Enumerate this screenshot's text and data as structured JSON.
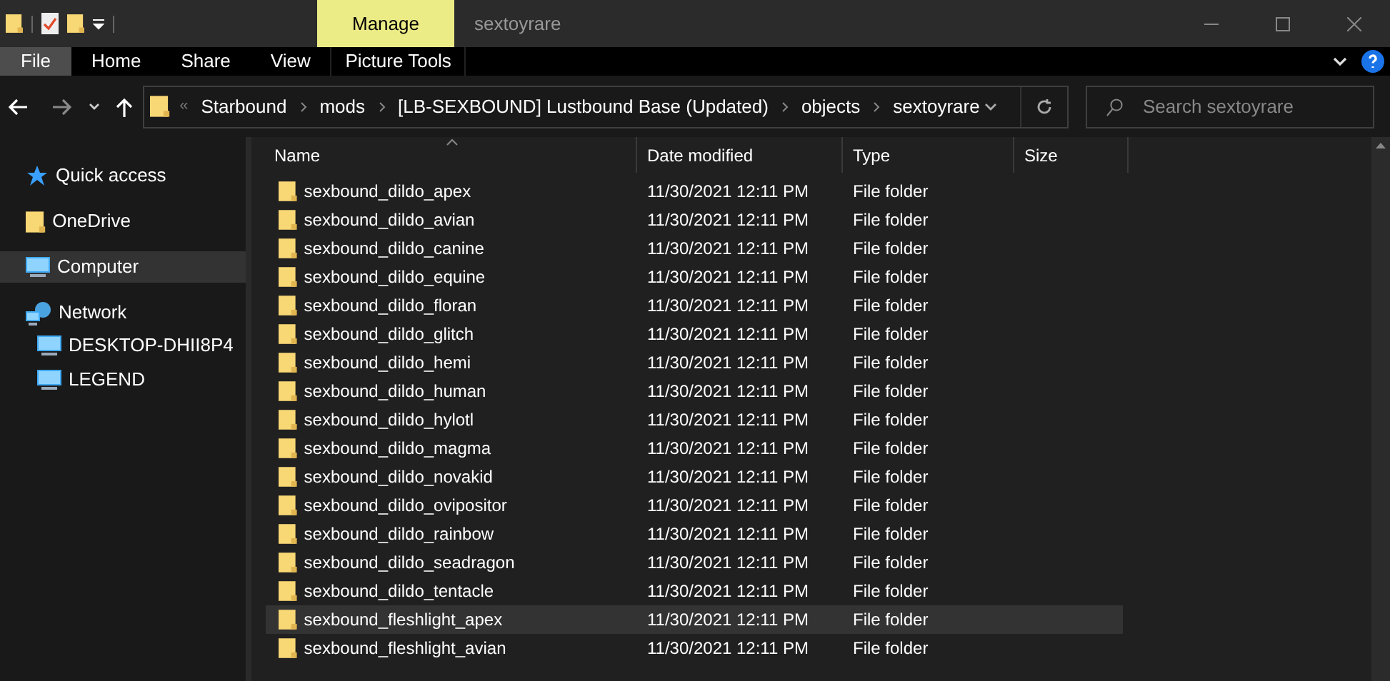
{
  "window": {
    "title": "sextoyrare",
    "contextual_tab": "Manage"
  },
  "ribbon_tabs": [
    {
      "label": "File",
      "kind": "file",
      "selected": true
    },
    {
      "label": "Home",
      "kind": "tab",
      "selected": false
    },
    {
      "label": "Share",
      "kind": "tab",
      "selected": false
    },
    {
      "label": "View",
      "kind": "tab",
      "selected": false
    },
    {
      "label": "Picture Tools",
      "kind": "contextual",
      "selected": false
    }
  ],
  "address_bar": {
    "overflow": "«",
    "path": [
      "Starbound",
      "mods",
      "[LB-SEXBOUND] Lustbound Base (Updated)",
      "objects",
      "sextoyrare"
    ]
  },
  "search": {
    "placeholder": "Search sextoyrare"
  },
  "sidebar": {
    "items": [
      {
        "label": "Quick access",
        "kind": "star",
        "selected": false
      },
      {
        "label": "OneDrive",
        "kind": "folder",
        "selected": false
      },
      {
        "label": "Computer",
        "kind": "computer",
        "selected": true
      },
      {
        "label": "Network",
        "kind": "network",
        "selected": false,
        "children": [
          {
            "label": "DESKTOP-DHII8P4",
            "kind": "computer",
            "selected": false
          },
          {
            "label": "LEGEND",
            "kind": "computer",
            "selected": false
          }
        ]
      }
    ]
  },
  "table": {
    "columns": [
      "Name",
      "Date modified",
      "Type",
      "Size"
    ],
    "rows": [
      {
        "name": "sexbound_dildo_apex",
        "date": "11/30/2021 12:11 PM",
        "type": "File folder",
        "selected": false
      },
      {
        "name": "sexbound_dildo_avian",
        "date": "11/30/2021 12:11 PM",
        "type": "File folder",
        "selected": false
      },
      {
        "name": "sexbound_dildo_canine",
        "date": "11/30/2021 12:11 PM",
        "type": "File folder",
        "selected": false
      },
      {
        "name": "sexbound_dildo_equine",
        "date": "11/30/2021 12:11 PM",
        "type": "File folder",
        "selected": false
      },
      {
        "name": "sexbound_dildo_floran",
        "date": "11/30/2021 12:11 PM",
        "type": "File folder",
        "selected": false
      },
      {
        "name": "sexbound_dildo_glitch",
        "date": "11/30/2021 12:11 PM",
        "type": "File folder",
        "selected": false
      },
      {
        "name": "sexbound_dildo_hemi",
        "date": "11/30/2021 12:11 PM",
        "type": "File folder",
        "selected": false
      },
      {
        "name": "sexbound_dildo_human",
        "date": "11/30/2021 12:11 PM",
        "type": "File folder",
        "selected": false
      },
      {
        "name": "sexbound_dildo_hylotl",
        "date": "11/30/2021 12:11 PM",
        "type": "File folder",
        "selected": false
      },
      {
        "name": "sexbound_dildo_magma",
        "date": "11/30/2021 12:11 PM",
        "type": "File folder",
        "selected": false
      },
      {
        "name": "sexbound_dildo_novakid",
        "date": "11/30/2021 12:11 PM",
        "type": "File folder",
        "selected": false
      },
      {
        "name": "sexbound_dildo_ovipositor",
        "date": "11/30/2021 12:11 PM",
        "type": "File folder",
        "selected": false
      },
      {
        "name": "sexbound_dildo_rainbow",
        "date": "11/30/2021 12:11 PM",
        "type": "File folder",
        "selected": false
      },
      {
        "name": "sexbound_dildo_seadragon",
        "date": "11/30/2021 12:11 PM",
        "type": "File folder",
        "selected": false
      },
      {
        "name": "sexbound_dildo_tentacle",
        "date": "11/30/2021 12:11 PM",
        "type": "File folder",
        "selected": false
      },
      {
        "name": "sexbound_fleshlight_apex",
        "date": "11/30/2021 12:11 PM",
        "type": "File folder",
        "selected": true
      },
      {
        "name": "sexbound_fleshlight_avian",
        "date": "11/30/2021 12:11 PM",
        "type": "File folder",
        "selected": false
      }
    ]
  }
}
